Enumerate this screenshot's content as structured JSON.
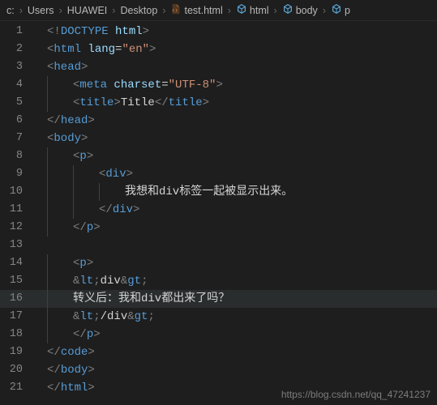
{
  "breadcrumb": {
    "items": [
      {
        "label": "c:",
        "icon": null
      },
      {
        "label": "Users",
        "icon": null
      },
      {
        "label": "HUAWEI",
        "icon": null
      },
      {
        "label": "Desktop",
        "icon": null
      },
      {
        "label": "test.html",
        "icon": "file-code"
      },
      {
        "label": "html",
        "icon": "symbol"
      },
      {
        "label": "body",
        "icon": "symbol"
      },
      {
        "label": "p",
        "icon": "symbol"
      }
    ]
  },
  "code": {
    "lines": [
      {
        "n": 1,
        "indent": 0,
        "parts": [
          {
            "t": "<",
            "c": "bracket"
          },
          {
            "t": "!",
            "c": "bracket"
          },
          {
            "t": "DOCTYPE ",
            "c": "doctype"
          },
          {
            "t": "html",
            "c": "attr"
          },
          {
            "t": ">",
            "c": "bracket"
          }
        ]
      },
      {
        "n": 2,
        "indent": 0,
        "parts": [
          {
            "t": "<",
            "c": "bracket"
          },
          {
            "t": "html ",
            "c": "tag"
          },
          {
            "t": "lang",
            "c": "attr"
          },
          {
            "t": "=",
            "c": "text"
          },
          {
            "t": "\"en\"",
            "c": "string"
          },
          {
            "t": ">",
            "c": "bracket"
          }
        ]
      },
      {
        "n": 3,
        "indent": 0,
        "parts": [
          {
            "t": "<",
            "c": "bracket"
          },
          {
            "t": "head",
            "c": "tag"
          },
          {
            "t": ">",
            "c": "bracket"
          }
        ]
      },
      {
        "n": 4,
        "indent": 1,
        "parts": [
          {
            "t": "<",
            "c": "bracket"
          },
          {
            "t": "meta ",
            "c": "tag"
          },
          {
            "t": "charset",
            "c": "attr"
          },
          {
            "t": "=",
            "c": "text"
          },
          {
            "t": "\"UTF-8\"",
            "c": "string"
          },
          {
            "t": ">",
            "c": "bracket"
          }
        ]
      },
      {
        "n": 5,
        "indent": 1,
        "parts": [
          {
            "t": "<",
            "c": "bracket"
          },
          {
            "t": "title",
            "c": "tag"
          },
          {
            "t": ">",
            "c": "bracket"
          },
          {
            "t": "Title",
            "c": "text"
          },
          {
            "t": "</",
            "c": "bracket"
          },
          {
            "t": "title",
            "c": "tag"
          },
          {
            "t": ">",
            "c": "bracket"
          }
        ]
      },
      {
        "n": 6,
        "indent": 0,
        "parts": [
          {
            "t": "</",
            "c": "bracket"
          },
          {
            "t": "head",
            "c": "tag"
          },
          {
            "t": ">",
            "c": "bracket"
          }
        ]
      },
      {
        "n": 7,
        "indent": 0,
        "parts": [
          {
            "t": "<",
            "c": "bracket"
          },
          {
            "t": "body",
            "c": "tag"
          },
          {
            "t": ">",
            "c": "bracket"
          }
        ]
      },
      {
        "n": 8,
        "indent": 1,
        "parts": [
          {
            "t": "<",
            "c": "bracket"
          },
          {
            "t": "p",
            "c": "tag"
          },
          {
            "t": ">",
            "c": "bracket"
          }
        ]
      },
      {
        "n": 9,
        "indent": 2,
        "parts": [
          {
            "t": "<",
            "c": "bracket"
          },
          {
            "t": "div",
            "c": "tag"
          },
          {
            "t": ">",
            "c": "bracket"
          }
        ]
      },
      {
        "n": 10,
        "indent": 3,
        "parts": [
          {
            "t": "我想和div标签一起被显示出来。",
            "c": "text"
          }
        ]
      },
      {
        "n": 11,
        "indent": 2,
        "parts": [
          {
            "t": "</",
            "c": "bracket"
          },
          {
            "t": "div",
            "c": "tag"
          },
          {
            "t": ">",
            "c": "bracket"
          }
        ]
      },
      {
        "n": 12,
        "indent": 1,
        "parts": [
          {
            "t": "</",
            "c": "bracket"
          },
          {
            "t": "p",
            "c": "tag"
          },
          {
            "t": ">",
            "c": "bracket"
          }
        ]
      },
      {
        "n": 13,
        "indent": 0,
        "parts": []
      },
      {
        "n": 14,
        "indent": 1,
        "parts": [
          {
            "t": "<",
            "c": "bracket"
          },
          {
            "t": "p",
            "c": "tag"
          },
          {
            "t": ">",
            "c": "bracket"
          }
        ]
      },
      {
        "n": 15,
        "indent": 1,
        "parts": [
          {
            "t": "&",
            "c": "entity-amp"
          },
          {
            "t": "lt",
            "c": "entity-name"
          },
          {
            "t": ";",
            "c": "entity-amp"
          },
          {
            "t": "div",
            "c": "text"
          },
          {
            "t": "&",
            "c": "entity-amp"
          },
          {
            "t": "gt",
            "c": "entity-name"
          },
          {
            "t": ";",
            "c": "entity-amp"
          }
        ]
      },
      {
        "n": 16,
        "indent": 1,
        "parts": [
          {
            "t": "转义后：我和div都出来了吗？",
            "c": "text"
          }
        ],
        "highlight": true
      },
      {
        "n": 17,
        "indent": 1,
        "parts": [
          {
            "t": "&",
            "c": "entity-amp"
          },
          {
            "t": "lt",
            "c": "entity-name"
          },
          {
            "t": ";",
            "c": "entity-amp"
          },
          {
            "t": "/div",
            "c": "text"
          },
          {
            "t": "&",
            "c": "entity-amp"
          },
          {
            "t": "gt",
            "c": "entity-name"
          },
          {
            "t": ";",
            "c": "entity-amp"
          }
        ]
      },
      {
        "n": 18,
        "indent": 1,
        "parts": [
          {
            "t": "</",
            "c": "bracket"
          },
          {
            "t": "p",
            "c": "tag"
          },
          {
            "t": ">",
            "c": "bracket"
          }
        ]
      },
      {
        "n": 19,
        "indent": 0,
        "parts": [
          {
            "t": "</",
            "c": "bracket"
          },
          {
            "t": "code",
            "c": "tag"
          },
          {
            "t": ">",
            "c": "bracket"
          }
        ]
      },
      {
        "n": 20,
        "indent": 0,
        "parts": [
          {
            "t": "</",
            "c": "bracket"
          },
          {
            "t": "body",
            "c": "tag"
          },
          {
            "t": ">",
            "c": "bracket"
          }
        ]
      },
      {
        "n": 21,
        "indent": 0,
        "parts": [
          {
            "t": "</",
            "c": "bracket"
          },
          {
            "t": "html",
            "c": "tag"
          },
          {
            "t": ">",
            "c": "bracket"
          }
        ]
      }
    ]
  },
  "watermark": "https://blog.csdn.net/qq_47241237"
}
